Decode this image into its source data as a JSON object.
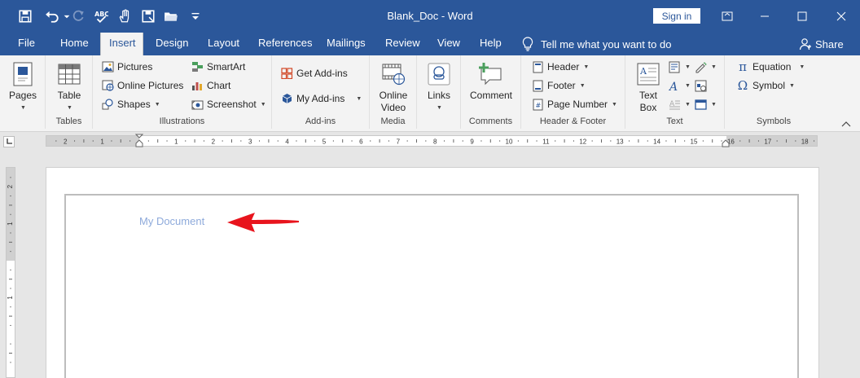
{
  "window": {
    "title": "Blank_Doc  -  Word",
    "signin_label": "Sign in"
  },
  "tabs": [
    "File",
    "Home",
    "Insert",
    "Design",
    "Layout",
    "References",
    "Mailings",
    "Review",
    "View",
    "Help"
  ],
  "active_tab": "Insert",
  "tellme": "Tell me what you want to do",
  "share": "Share",
  "ribbon": {
    "pages": {
      "label": "Pages"
    },
    "tables": {
      "table_label": "Table",
      "group": "Tables"
    },
    "illustrations": {
      "pictures": "Pictures",
      "online_pictures": "Online Pictures",
      "shapes": "Shapes",
      "smartart": "SmartArt",
      "chart": "Chart",
      "screenshot": "Screenshot",
      "group": "Illustrations"
    },
    "addins": {
      "get": "Get Add-ins",
      "my": "My Add-ins",
      "group": "Add-ins"
    },
    "media": {
      "online_video_1": "Online",
      "online_video_2": "Video",
      "group": "Media"
    },
    "links": {
      "label": "Links"
    },
    "comments": {
      "comment": "Comment",
      "group": "Comments"
    },
    "header_footer": {
      "header": "Header",
      "footer": "Footer",
      "page_number": "Page Number",
      "group": "Header & Footer"
    },
    "text": {
      "text_box_1": "Text",
      "text_box_2": "Box",
      "group": "Text"
    },
    "symbols": {
      "equation": "Equation",
      "symbol": "Symbol",
      "group": "Symbols"
    }
  },
  "ruler": {
    "ticks": [
      "2",
      "1",
      "1",
      "2",
      "3",
      "4",
      "5",
      "6",
      "7",
      "8",
      "9",
      "10",
      "11",
      "12",
      "13",
      "14",
      "15",
      "16",
      "17",
      "18"
    ],
    "vticks": [
      "2",
      "1",
      "1"
    ]
  },
  "document": {
    "text": "My Document"
  },
  "colors": {
    "accent": "#2b579a",
    "annotation_arrow": "#e8141d",
    "doc_text": "#8eaadb"
  }
}
